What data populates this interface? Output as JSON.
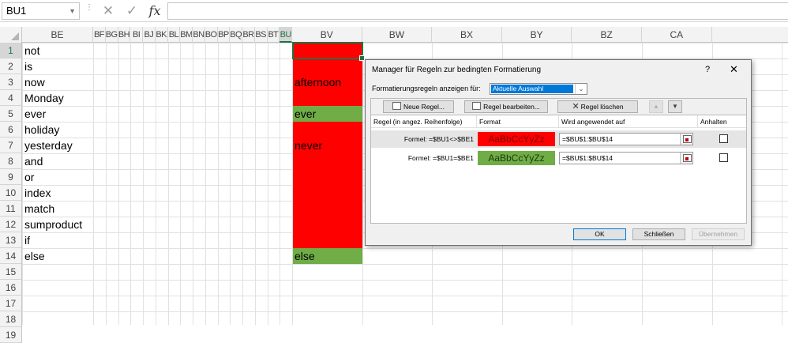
{
  "formula_bar": {
    "name_box": "BU1",
    "cancel_glyph": "✕",
    "enter_glyph": "✓",
    "fx_glyph": "fx",
    "formula": ""
  },
  "columns": [
    {
      "label": "BE",
      "sel": false
    },
    {
      "label": "BF",
      "sel": false
    },
    {
      "label": "BG",
      "sel": false
    },
    {
      "label": "BH",
      "sel": false
    },
    {
      "label": "BI",
      "sel": false
    },
    {
      "label": "BJ",
      "sel": false
    },
    {
      "label": "BK",
      "sel": false
    },
    {
      "label": "BL",
      "sel": false
    },
    {
      "label": "BM",
      "sel": false
    },
    {
      "label": "BN",
      "sel": false
    },
    {
      "label": "BO",
      "sel": false
    },
    {
      "label": "BP",
      "sel": false
    },
    {
      "label": "BQ",
      "sel": false
    },
    {
      "label": "BR",
      "sel": false
    },
    {
      "label": "BS",
      "sel": false
    },
    {
      "label": "BT",
      "sel": false
    },
    {
      "label": "BU",
      "sel": true
    },
    {
      "label": "BV",
      "sel": false
    },
    {
      "label": "BW",
      "sel": false
    },
    {
      "label": "BX",
      "sel": false
    },
    {
      "label": "BY",
      "sel": false
    },
    {
      "label": "BZ",
      "sel": false
    },
    {
      "label": "CA",
      "sel": false
    }
  ],
  "rows": [
    "1",
    "2",
    "3",
    "4",
    "5",
    "6",
    "7",
    "8",
    "9",
    "10",
    "11",
    "12",
    "13",
    "14",
    "15",
    "16",
    "17",
    "18",
    "19"
  ],
  "be_values": [
    "not",
    "is",
    "now",
    "Monday",
    "ever",
    "holiday",
    "yesterday",
    "and",
    "or",
    "index",
    "match",
    "sumproduct",
    "if",
    "else"
  ],
  "bu_values": [
    "",
    "",
    "afternoon",
    "",
    "ever",
    "",
    "never",
    "",
    "",
    "",
    "",
    "",
    "",
    "else"
  ],
  "colors": {
    "red": "#ff0000",
    "green": "#70ad47",
    "excel_green": "#217346",
    "selection_blue": "#0078d7"
  },
  "dialog": {
    "title": "Manager für Regeln zur bedingten Formatierung",
    "help": "?",
    "close": "✕",
    "show_rules_label": "Formatierungsregeln anzeigen für:",
    "show_rules_value": "Aktuelle Auswahl",
    "buttons": {
      "new_rule": "Neue Regel...",
      "edit_rule": "Regel bearbeiten...",
      "delete_rule": "Regel löschen",
      "move_up": "▲",
      "move_down": "▼"
    },
    "headers": {
      "rule": "Regel (in angez. Reihenfolge)",
      "format": "Format",
      "applies_to": "Wird angewendet auf",
      "stop": "Anhalten"
    },
    "rules": [
      {
        "condition": "Formel: =$BU1<>$BE1",
        "preview": "AaBbCcYyZz",
        "applies_to": "=$BU$1:$BU$14",
        "color": "#ff0000",
        "text_color": "#7a0000"
      },
      {
        "condition": "Formel: =$BU1=$BE1",
        "preview": "AaBbCcYyZz",
        "applies_to": "=$BU$1:$BU$14",
        "color": "#70ad47",
        "text_color": "#1c3a0c"
      }
    ],
    "ok": "OK",
    "close_button": "Schließen",
    "apply": "Übernehmen"
  }
}
